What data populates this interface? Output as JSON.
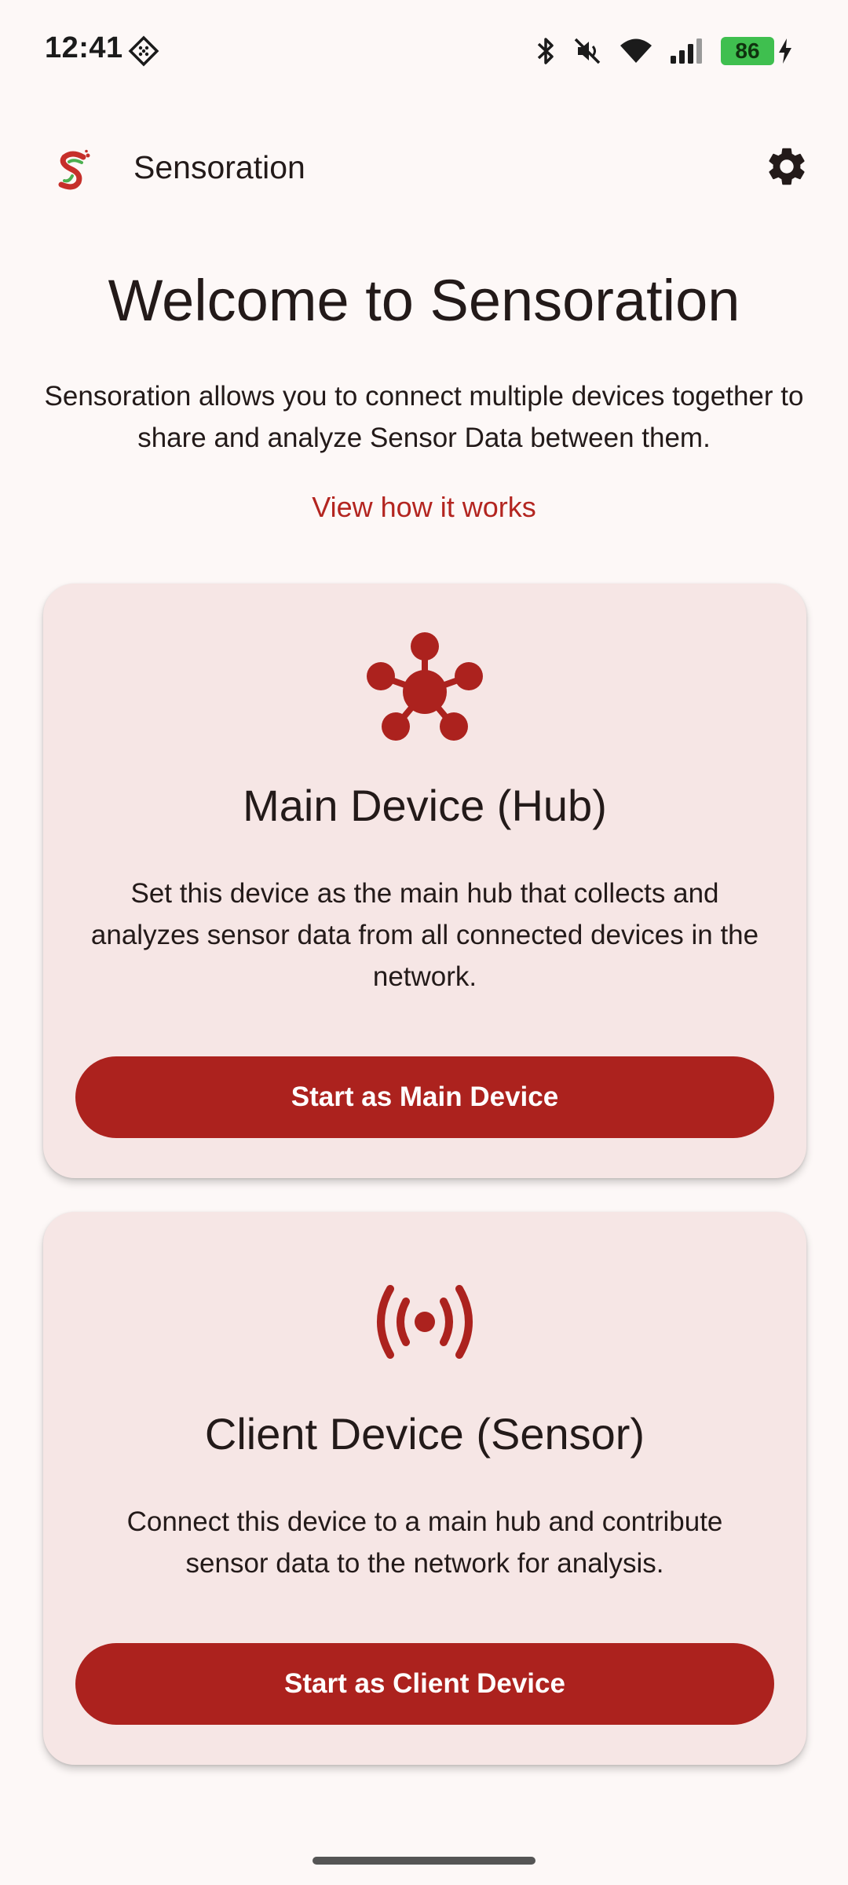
{
  "status_bar": {
    "time": "12:41",
    "battery_level": "86",
    "icons": [
      "sync-icon",
      "bluetooth-icon",
      "mute-icon",
      "wifi-icon",
      "signal-icon",
      "battery-icon",
      "charging-icon"
    ]
  },
  "app_bar": {
    "title": "Sensoration",
    "logo_icon": "sensoration-logo-icon",
    "settings_icon": "gear-icon"
  },
  "welcome": {
    "title": "Welcome to Sensoration",
    "description": "Sensoration allows you to connect multiple devices together to share and analyze Sensor Data between them.",
    "link": "View how it works"
  },
  "cards": [
    {
      "icon": "hub-icon",
      "title": "Main Device (Hub)",
      "description": "Set this device as the main hub that collects and analyzes sensor data from all connected devices in the network.",
      "button_label": "Start as Main Device"
    },
    {
      "icon": "sensor-broadcast-icon",
      "title": "Client Device (Sensor)",
      "description": "Connect this device to a main hub and contribute sensor data to the network for analysis.",
      "button_label": "Start as Client Device"
    }
  ],
  "colors": {
    "primary": "#ac221e",
    "background": "#fdf8f7",
    "card_background": "#f6e6e5",
    "text": "#231a19",
    "battery": "#3fbf4f"
  }
}
